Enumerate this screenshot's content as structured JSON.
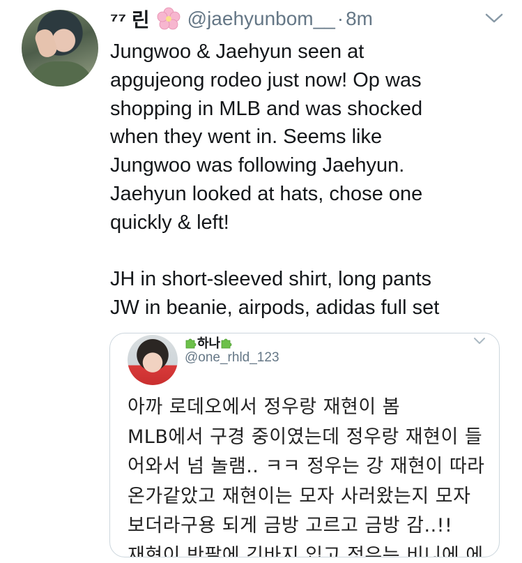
{
  "tweet": {
    "display_name": "⁷⁷ 린",
    "name_emoji": "cherry-blossom",
    "handle": "@jaehyunbom__",
    "separator": "·",
    "time": "8m",
    "text": "Jungwoo & Jaehyun seen at\napgujeong rodeo just now! Op was\nshopping in MLB and was shocked\nwhen they went in. Seems like\nJungwoo was following Jaehyun.\nJaehyun looked at hats, chose one\nquickly & left!\n\nJH in short-sleeved shirt, long pants\nJW in beanie, airpods, adidas full set"
  },
  "quoted_tweet": {
    "display_name": "하나",
    "name_emoji": "puzzle-piece",
    "handle": "@one_rhld_123",
    "text": "아까 로데오에서 정우랑 재현이 봄\nMLB에서 구경 중이였는데 정우랑 재현이 들\n어와서 넘 놀램.. ㅋㅋ 정우는 강 재현이 따라\n온가같았고 재현이는 모자 사러왔는지 모자\n보더라구용 되게 금방 고르고 금방 감..!!\n재현이 반팔에 긴바지 입고 정우는 비니에 에"
  },
  "colors": {
    "text": "#14171a",
    "secondary": "#657786",
    "border": "#ccd6dd"
  }
}
